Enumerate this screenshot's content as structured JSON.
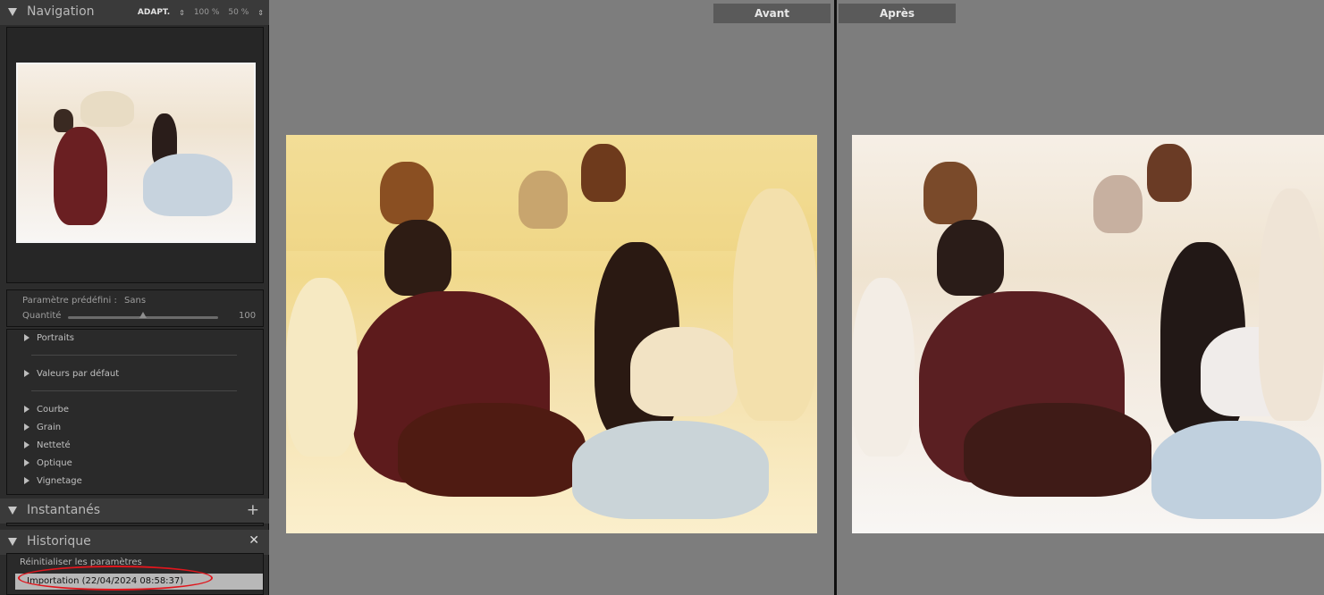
{
  "navigator": {
    "title": "Navigation",
    "zoom_options": [
      "ADAPT.",
      "100 %",
      "50 %"
    ]
  },
  "preset": {
    "label": "Paramètre prédéfini :",
    "value": "Sans",
    "amount_label": "Quantité",
    "amount_value": "100",
    "amount_fraction": 0.5
  },
  "sections": [
    "Portraits",
    "Valeurs par défaut",
    "Courbe",
    "Grain",
    "Netteté",
    "Optique",
    "Vignetage"
  ],
  "snapshots": {
    "title": "Instantanés"
  },
  "history": {
    "title": "Historique",
    "items": [
      "Réinitialiser les paramètres",
      "Importation (22/04/2024 08:58:37)"
    ]
  },
  "view": {
    "before_label": "Avant",
    "after_label": "Après"
  },
  "colors": {
    "panel_bg": "#2c2c2c",
    "main_bg": "#7d7d7d",
    "selected_row": "#b8b8b8",
    "annotation": "#e0161d"
  }
}
